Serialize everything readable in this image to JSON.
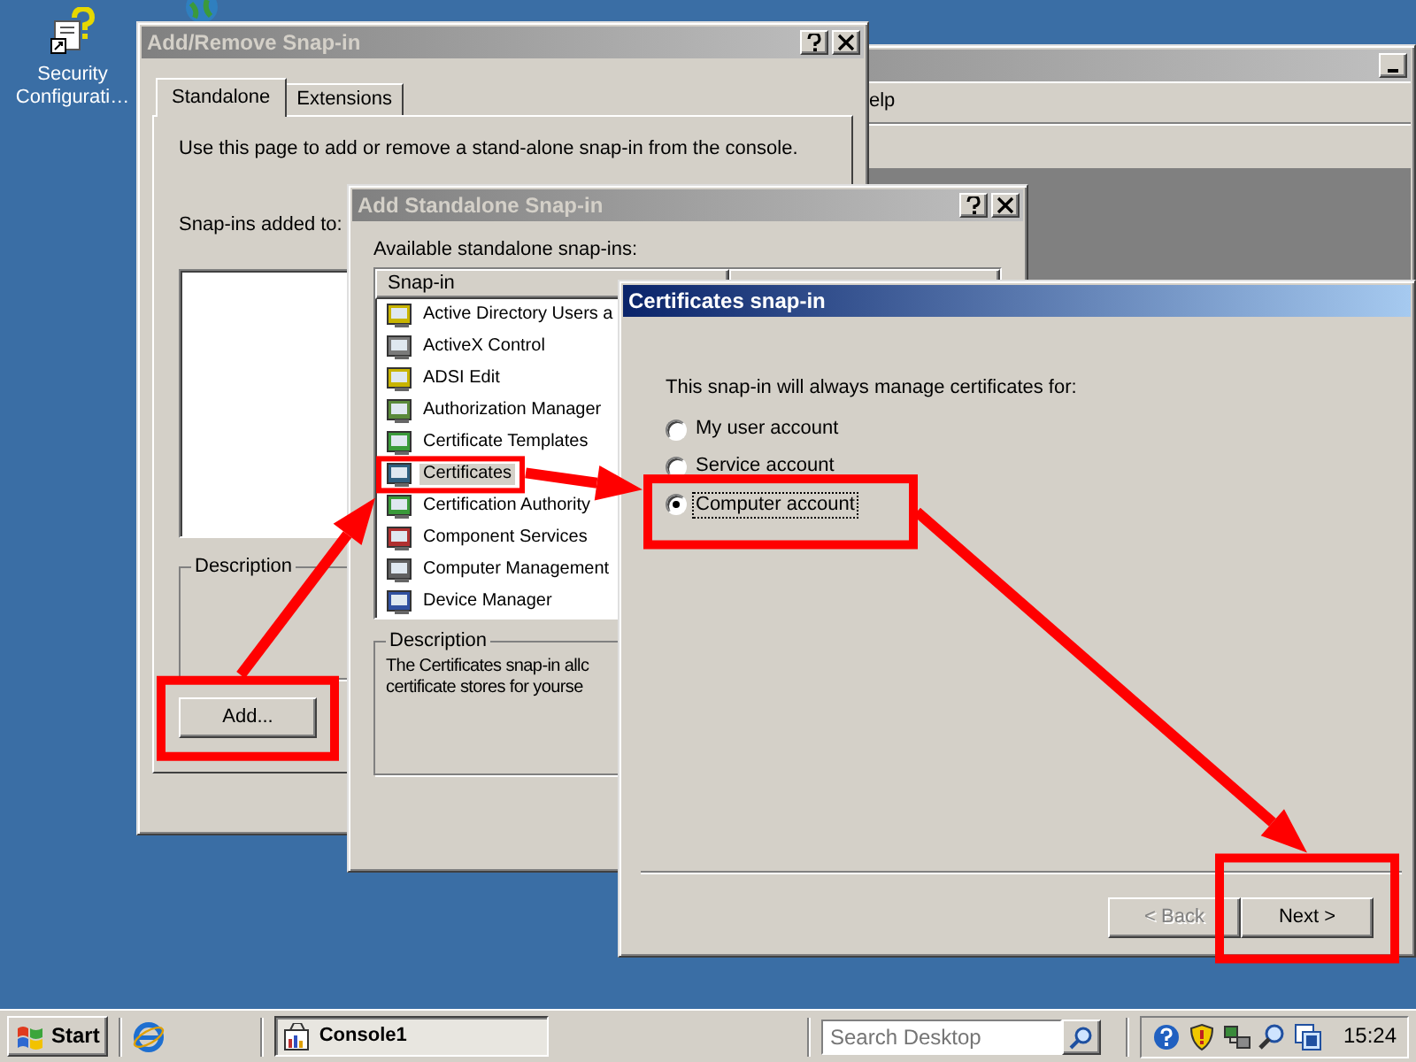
{
  "desktop_icons": [
    {
      "label": "Security Configurati…"
    }
  ],
  "console_window": {
    "menu_fragment": "elp"
  },
  "add_remove_dialog": {
    "title": "Add/Remove Snap-in",
    "active": false,
    "tabs": [
      {
        "label": "Standalone",
        "selected": true
      },
      {
        "label": "Extensions",
        "selected": false
      }
    ],
    "intro": "Use this page to add or remove a stand-alone snap-in from the console.",
    "added_to_label": "Snap-ins added to:",
    "description_label": "Description",
    "add_button": "Add..."
  },
  "add_standalone_dialog": {
    "title": "Add Standalone Snap-in",
    "active": false,
    "list_label": "Available standalone snap-ins:",
    "column_1": "Snap-in",
    "items": [
      {
        "label": "Active Directory Users a",
        "selected": false
      },
      {
        "label": "ActiveX Control",
        "selected": false
      },
      {
        "label": "ADSI Edit",
        "selected": false
      },
      {
        "label": "Authorization Manager",
        "selected": false
      },
      {
        "label": "Certificate Templates",
        "selected": false
      },
      {
        "label": "Certificates",
        "selected": true
      },
      {
        "label": "Certification Authority",
        "selected": false
      },
      {
        "label": "Component Services",
        "selected": false
      },
      {
        "label": "Computer Management",
        "selected": false
      },
      {
        "label": "Device Manager",
        "selected": false
      }
    ],
    "description_label": "Description",
    "description_lines": [
      "The Certificates snap-in allc",
      "certificate stores for yourse"
    ]
  },
  "certificates_dialog": {
    "title": "Certificates snap-in",
    "active": true,
    "prompt": "This snap-in will always manage certificates for:",
    "options": [
      {
        "label": "My user account",
        "selected": false
      },
      {
        "label": "Service account",
        "selected": false
      },
      {
        "label": "Computer account",
        "selected": true
      }
    ],
    "buttons": [
      {
        "label": "< Back",
        "disabled": true
      },
      {
        "label": "Next >",
        "disabled": false
      }
    ]
  },
  "taskbar": {
    "start": "Start",
    "tasks": [
      {
        "label": "Console1",
        "selected": true
      }
    ],
    "search": {
      "placeholder": "Search Desktop"
    },
    "clock": "15:24"
  }
}
